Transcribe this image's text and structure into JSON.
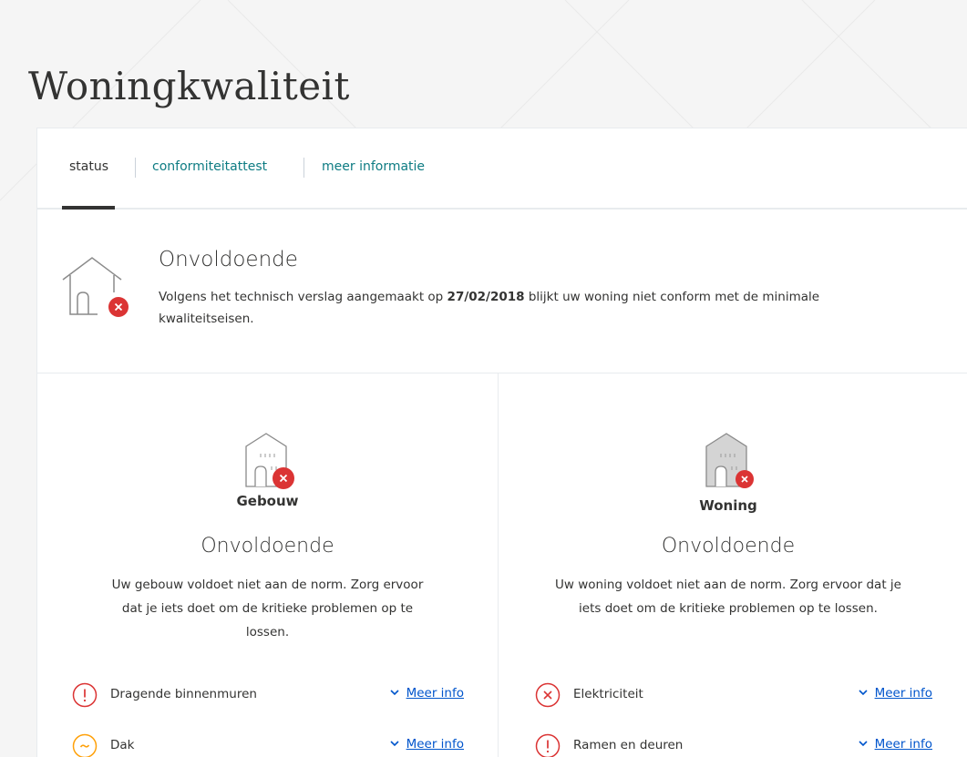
{
  "page": {
    "title": "Woningkwaliteit"
  },
  "tabs": [
    {
      "label": "status",
      "active": true
    },
    {
      "label": "conformiteitattest",
      "active": false
    },
    {
      "label": "meer informatie",
      "active": false
    }
  ],
  "status": {
    "title": "Onvoldoende",
    "desc_before": "Volgens het technisch verslag aangemaakt op ",
    "date": "27/02/2018",
    "desc_after": " blijkt uw woning niet conform met de minimale kwaliteitseisen."
  },
  "columns": [
    {
      "label": "Gebouw",
      "status": "Onvoldoende",
      "desc": "Uw gebouw voldoet niet aan de norm. Zorg ervoor dat je iets doet om de kritieke problemen op te lossen.",
      "problems": [
        {
          "label": "Dragende binnenmuren",
          "severity": "warning",
          "link": "Meer info"
        },
        {
          "label": "Dak",
          "severity": "minor",
          "link": "Meer info"
        }
      ]
    },
    {
      "label": "Woning",
      "status": "Onvoldoende",
      "desc": "Uw woning voldoet niet aan de norm. Zorg ervoor dat je iets doet om de kritieke problemen op te lossen.",
      "problems": [
        {
          "label": "Elektriciteit",
          "severity": "critical",
          "link": "Meer info"
        },
        {
          "label": "Ramen en deuren",
          "severity": "warning",
          "link": "Meer info"
        }
      ]
    }
  ],
  "colors": {
    "accent": "#0e7c83",
    "link": "#0055cc",
    "error": "#db3434",
    "warning": "#ffa10a",
    "text": "#333332"
  },
  "icons": {
    "house": "house-error-icon",
    "building": "building-error-icon",
    "apartment": "apartment-error-icon",
    "critical": "x-circle-icon",
    "warning": "exclamation-circle-icon",
    "minor": "tilde-circle-icon",
    "chevron": "chevron-down-icon"
  }
}
